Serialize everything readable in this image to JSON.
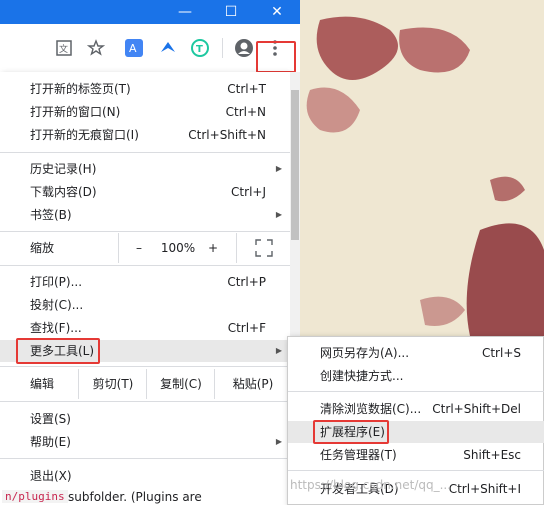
{
  "window": {
    "minimize": "—",
    "maximize": "☐",
    "close": "✕"
  },
  "toolbar": {
    "icons": [
      "translate-icon",
      "star-icon",
      "extension-translate-icon",
      "extension-bird-icon",
      "extension-t-icon",
      "profile-icon",
      "menu-kebab-icon"
    ]
  },
  "menu": {
    "new_tab": {
      "label": "打开新的标签页(T)",
      "shortcut": "Ctrl+T"
    },
    "new_window": {
      "label": "打开新的窗口(N)",
      "shortcut": "Ctrl+N"
    },
    "new_incognito": {
      "label": "打开新的无痕窗口(I)",
      "shortcut": "Ctrl+Shift+N"
    },
    "history": {
      "label": "历史记录(H)"
    },
    "downloads": {
      "label": "下载内容(D)",
      "shortcut": "Ctrl+J"
    },
    "bookmarks": {
      "label": "书签(B)"
    },
    "zoom": {
      "label": "缩放",
      "minus": "–",
      "value": "100%",
      "plus": "+"
    },
    "print": {
      "label": "打印(P)...",
      "shortcut": "Ctrl+P"
    },
    "cast": {
      "label": "投射(C)..."
    },
    "find": {
      "label": "查找(F)...",
      "shortcut": "Ctrl+F"
    },
    "more_tools": {
      "label": "更多工具(L)"
    },
    "edit": {
      "label": "编辑",
      "cut": "剪切(T)",
      "copy": "复制(C)",
      "paste": "粘贴(P)"
    },
    "settings": {
      "label": "设置(S)"
    },
    "help": {
      "label": "帮助(E)"
    },
    "exit": {
      "label": "退出(X)"
    }
  },
  "submenu": {
    "save_page": {
      "label": "网页另存为(A)...",
      "shortcut": "Ctrl+S"
    },
    "create_shortcut": {
      "label": "创建快捷方式..."
    },
    "clear_data": {
      "label": "清除浏览数据(C)...",
      "shortcut": "Ctrl+Shift+Del"
    },
    "extensions": {
      "label": "扩展程序(E)"
    },
    "task_manager": {
      "label": "任务管理器(T)",
      "shortcut": "Shift+Esc"
    },
    "devtools": {
      "label": "开发者工具(D)",
      "shortcut": "Ctrl+Shift+I"
    }
  },
  "background": {
    "code_snippet": "n/plugins",
    "text_snippet": "subfolder. (Plugins are"
  },
  "watermark": "https://blog.csdn.net/qq_..."
}
